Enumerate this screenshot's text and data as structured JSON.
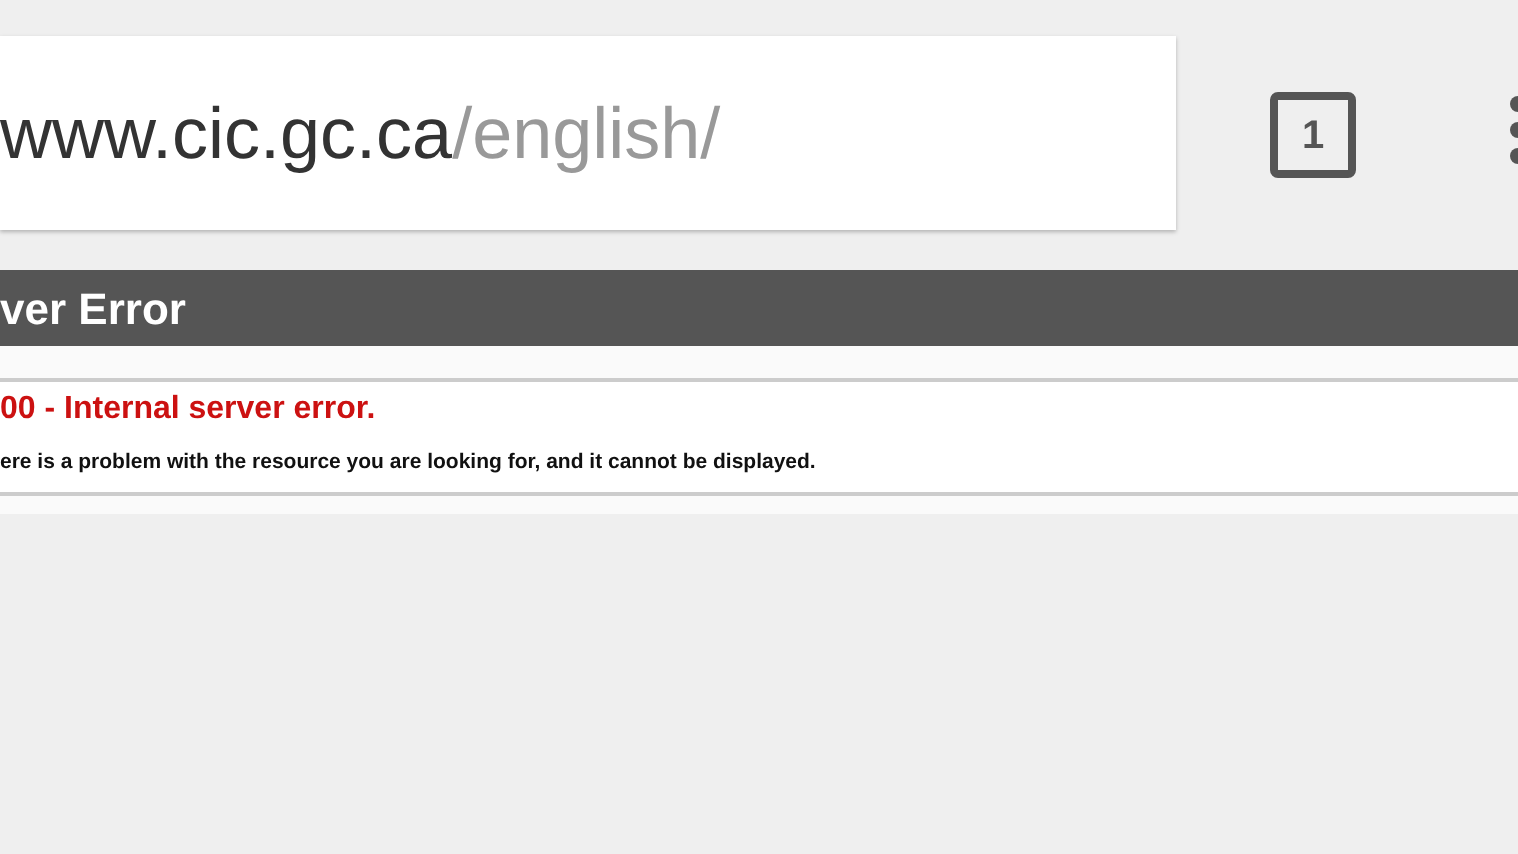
{
  "address_bar": {
    "host": "www.cic.gc.ca",
    "path": "/english/"
  },
  "tab_count": "1",
  "page": {
    "header": "ver Error",
    "error_title": "00 - Internal server error.",
    "error_message": "ere is a problem with the resource you are looking for, and it cannot be displayed."
  }
}
